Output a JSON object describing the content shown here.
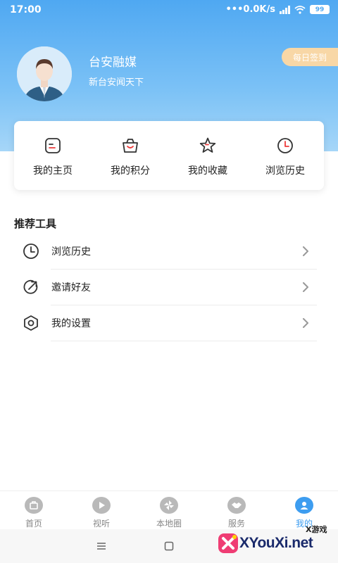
{
  "status": {
    "time": "17:00",
    "network": "0.0K/s",
    "battery": "99"
  },
  "profile": {
    "name": "台安融媒",
    "subtitle": "新台安闻天下",
    "checkin_label": "每日签到"
  },
  "quick_actions": [
    {
      "label": "我的主页",
      "icon": "homepage-icon"
    },
    {
      "label": "我的积分",
      "icon": "shopping-bag-icon"
    },
    {
      "label": "我的收藏",
      "icon": "star-icon"
    },
    {
      "label": "浏览历史",
      "icon": "clock-icon"
    }
  ],
  "tools": {
    "title": "推荐工具",
    "items": [
      {
        "label": "浏览历史",
        "icon": "clock-icon"
      },
      {
        "label": "邀请好友",
        "icon": "invite-icon"
      },
      {
        "label": "我的设置",
        "icon": "settings-icon"
      }
    ]
  },
  "bottom_nav": {
    "active_index": 4,
    "items": [
      {
        "label": "首页",
        "icon": "home-icon"
      },
      {
        "label": "视听",
        "icon": "play-icon"
      },
      {
        "label": "本地圈",
        "icon": "pinwheel-icon"
      },
      {
        "label": "服务",
        "icon": "handshake-icon"
      },
      {
        "label": "我的",
        "icon": "user-icon"
      }
    ]
  },
  "watermark": {
    "small": "X游戏",
    "text": "XYouXi.net"
  },
  "colors": {
    "header_top": "#4fa8f2",
    "header_bottom": "#a6d6f8",
    "accent": "#3d9df0",
    "checkin_bg": "#f8d7a6",
    "icon_dark": "#333333"
  }
}
